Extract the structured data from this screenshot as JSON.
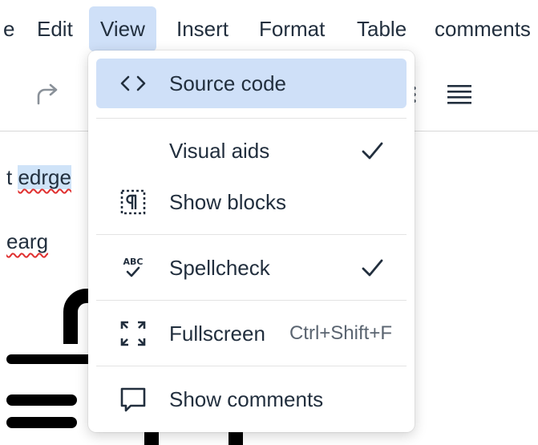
{
  "menubar": {
    "items": [
      {
        "label": "e"
      },
      {
        "label": "Edit"
      },
      {
        "label": "View"
      },
      {
        "label": "Insert"
      },
      {
        "label": "Format"
      },
      {
        "label": "Table"
      },
      {
        "label": "comments"
      }
    ]
  },
  "toolbar": {
    "redo_icon": "redo-icon",
    "more_icon": "more-vertical-icon",
    "justify_icon": "align-justify-icon"
  },
  "editor": {
    "line1_prefix": "t ",
    "line1_selected": "edrge",
    "line2": "earg"
  },
  "view_menu": {
    "items": [
      {
        "label": "Source code",
        "icon": "source-code-icon",
        "active": true
      },
      {
        "label": "Visual aids",
        "checked": true
      },
      {
        "label": "Show blocks",
        "icon": "show-blocks-icon"
      },
      {
        "label": "Spellcheck",
        "icon": "spellcheck-icon",
        "checked": true
      },
      {
        "label": "Fullscreen",
        "icon": "fullscreen-icon",
        "shortcut": "Ctrl+Shift+F"
      },
      {
        "label": "Show comments",
        "icon": "comment-icon"
      }
    ]
  },
  "colors": {
    "active_bg": "#cfe0f8",
    "text": "#222f3e",
    "selection": "#cfe3f8"
  }
}
